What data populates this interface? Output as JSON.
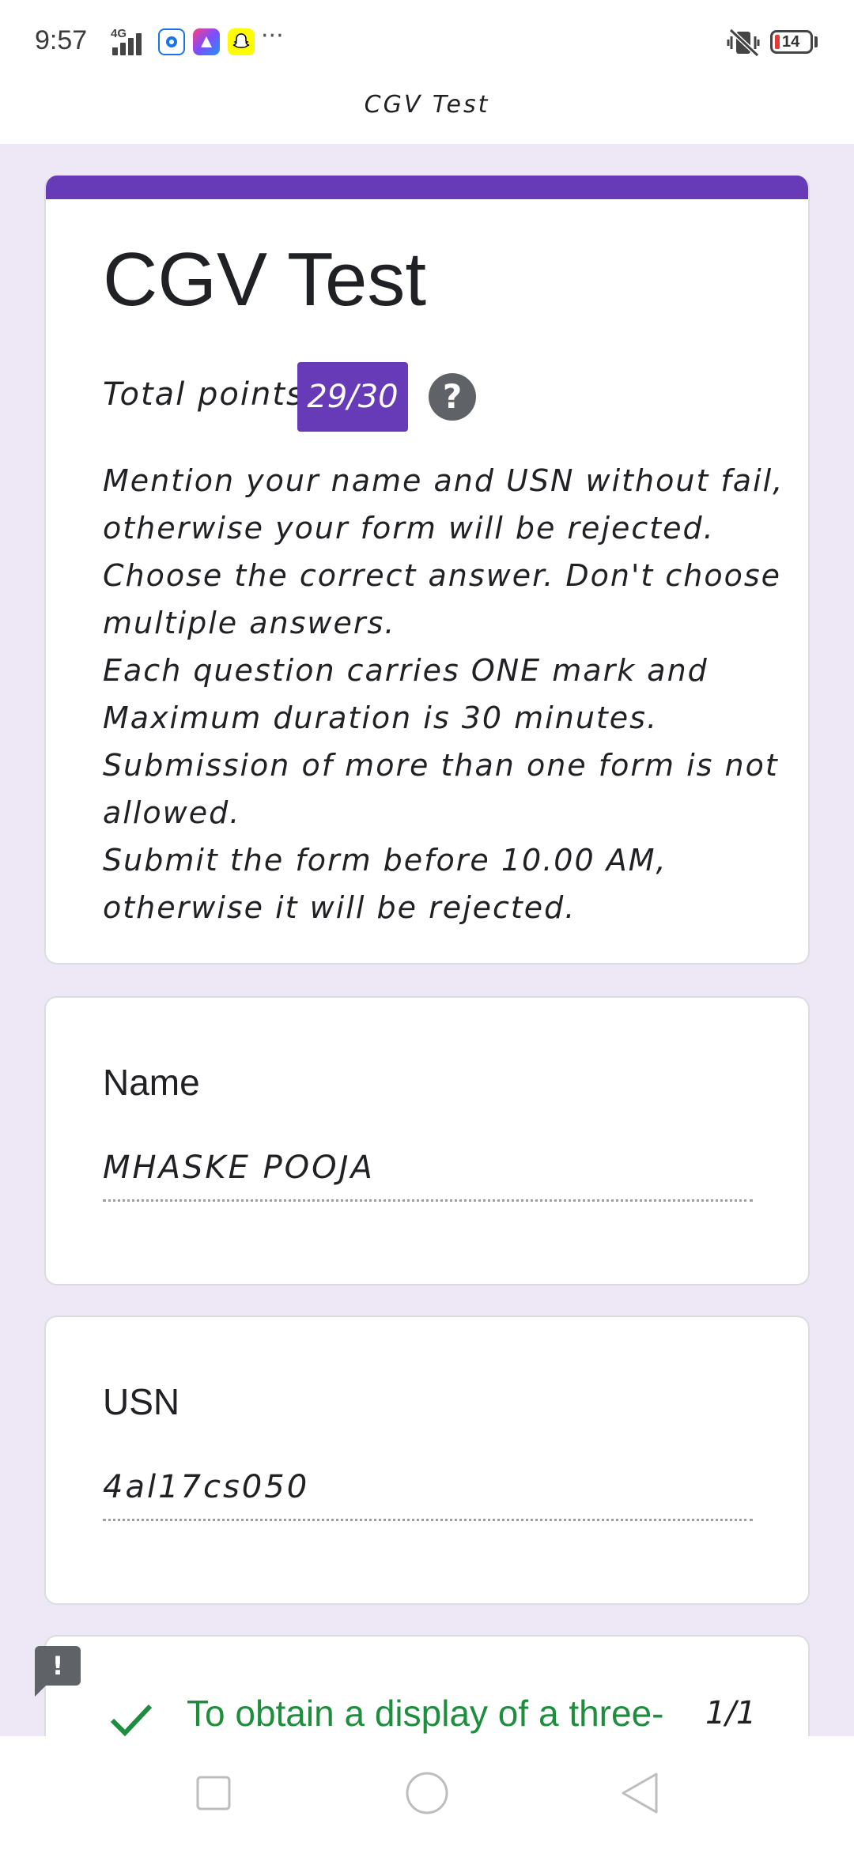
{
  "status_bar": {
    "time": "9:57",
    "network": "4G",
    "battery_level": "14",
    "colors": {
      "battery_low": "#e53935"
    }
  },
  "app_bar": {
    "title": "CGV Test"
  },
  "form": {
    "title": "CGV Test",
    "points_label": "Total points",
    "points_value": "29/30",
    "description_lines": [
      "Mention your name and USN without fail,",
      "otherwise your form will be rejected.",
      "Choose the correct answer. Don't choose",
      "multiple answers.",
      "Each question carries ONE mark and",
      "Maximum duration is 30 minutes.",
      "Submission of more than one form is not",
      "allowed.",
      "Submit the form before 10.00 AM,",
      "otherwise it will be rejected."
    ],
    "accent_color": "#673ab7"
  },
  "questions": {
    "name": {
      "label": "Name",
      "answer": "MHASKE POOJA"
    },
    "usn": {
      "label": "USN",
      "answer": "4al17cs050"
    },
    "q3": {
      "text": "To obtain a display of a three-",
      "score": "1/1"
    }
  }
}
